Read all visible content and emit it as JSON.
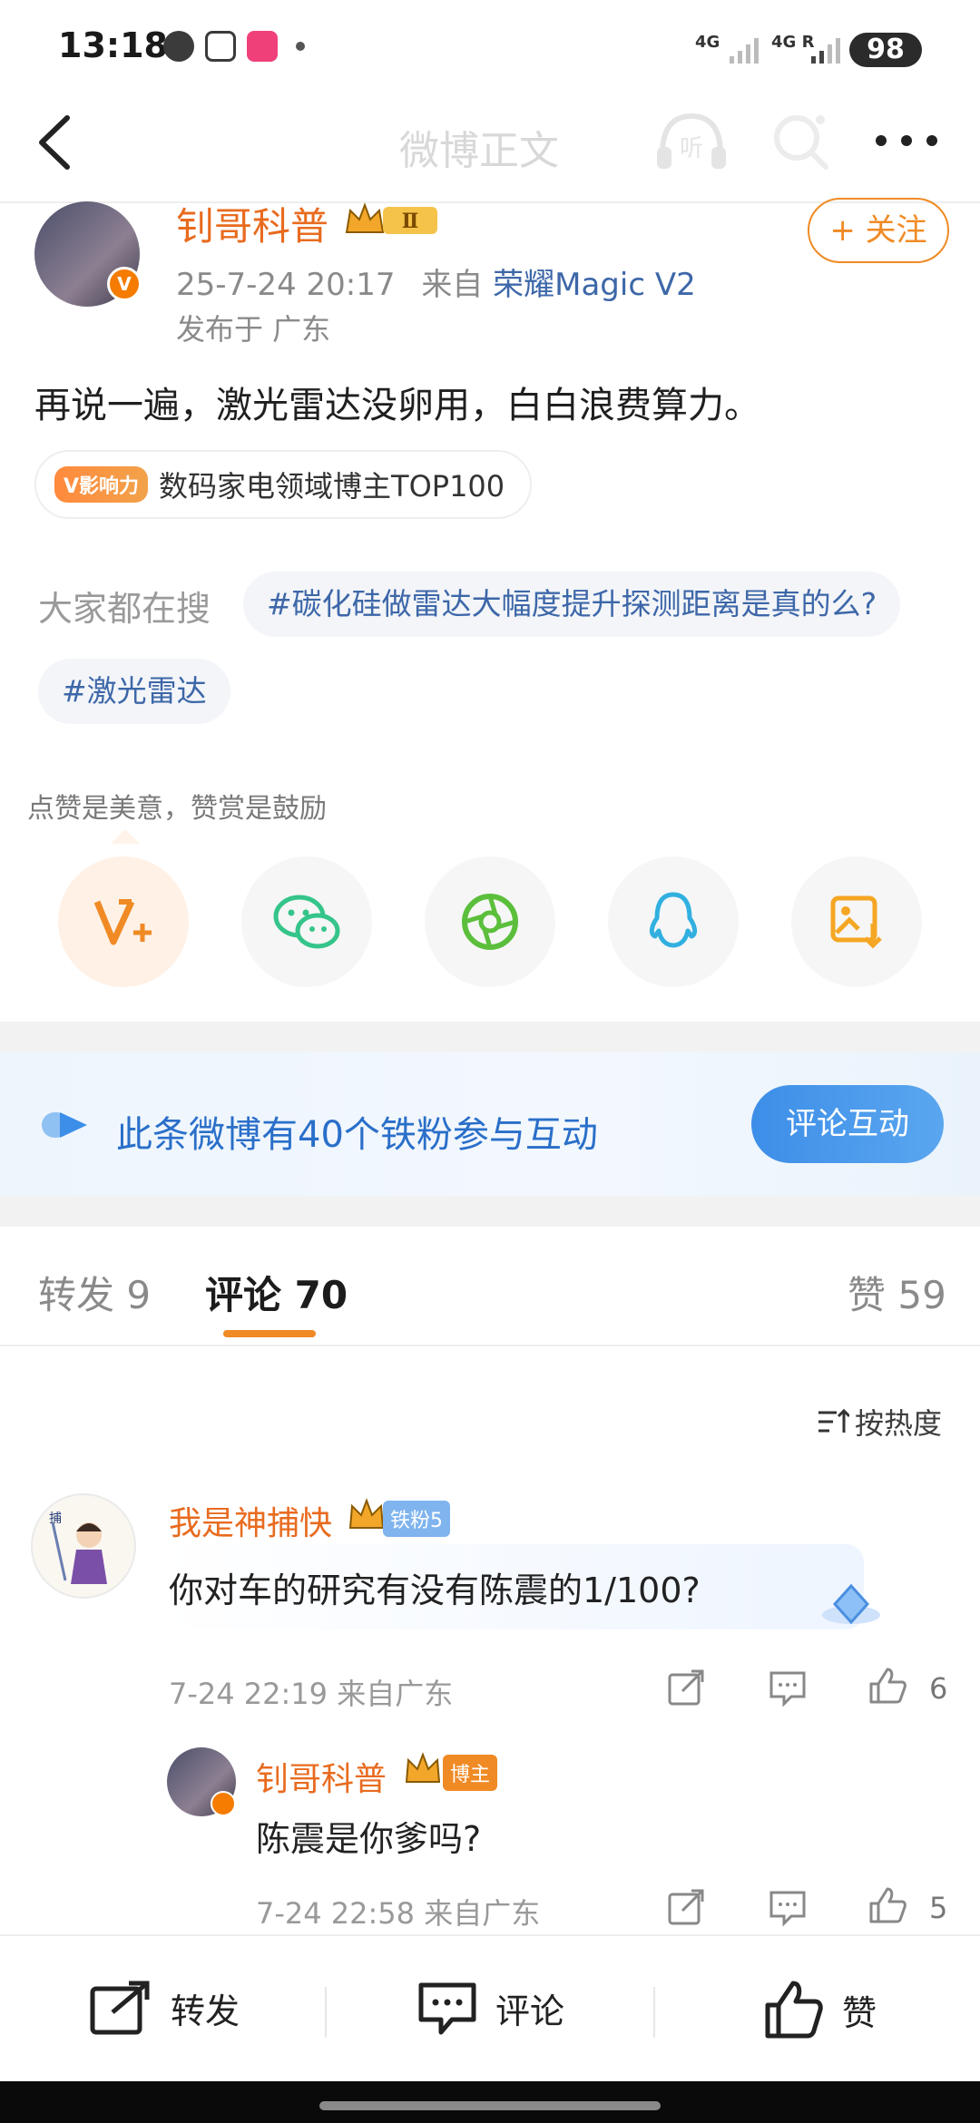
{
  "status_bar": {
    "time": "13:18",
    "signal1": "4G",
    "signal2": "4G R",
    "battery": "98"
  },
  "nav": {
    "title": "微博正文"
  },
  "post": {
    "author": "钊哥科普",
    "level_badge": "Ⅱ",
    "time": "25-7-24 20:17",
    "source_prefix": "来自",
    "device": "荣耀Magic V2",
    "location": "发布于 广东",
    "follow_label": "+ 关注",
    "text": "再说一遍，激光雷达没卵用，白白浪费算力。",
    "influence_tag": "V影响力",
    "influence_text": "数码家电领域博主TOP100"
  },
  "search": {
    "label": "大家都在搜",
    "chips": [
      "#碳化硅做雷达大幅度提升探测距离是真的么?",
      "#激光雷达"
    ]
  },
  "praise": {
    "label": "点赞是美意，赞赏是鼓励"
  },
  "iron_fans": {
    "text": "此条微博有40个铁粉参与互动",
    "button": "评论互动"
  },
  "tabs": {
    "repost": "转发 9",
    "comment": "评论 70",
    "like": "赞 59"
  },
  "sort_label": "按热度",
  "comments": [
    {
      "name": "我是神捕快",
      "badge": "铁粉5",
      "text": "你对车的研究有没有陈震的1/100?",
      "meta": "7-24 22:19  来自广东",
      "likes": "6"
    },
    {
      "name": "钊哥科普",
      "badge": "博主",
      "text": "陈震是你爹吗?",
      "meta": "7-24 22:58  来自广东",
      "likes": "5"
    }
  ],
  "bottom_bar": {
    "repost": "转发",
    "comment": "评论",
    "like": "赞"
  },
  "colors": {
    "accent": "#f08a24",
    "link": "#3d67a8",
    "name": "#e86b1f",
    "iron_blue": "#2a6fc9"
  }
}
